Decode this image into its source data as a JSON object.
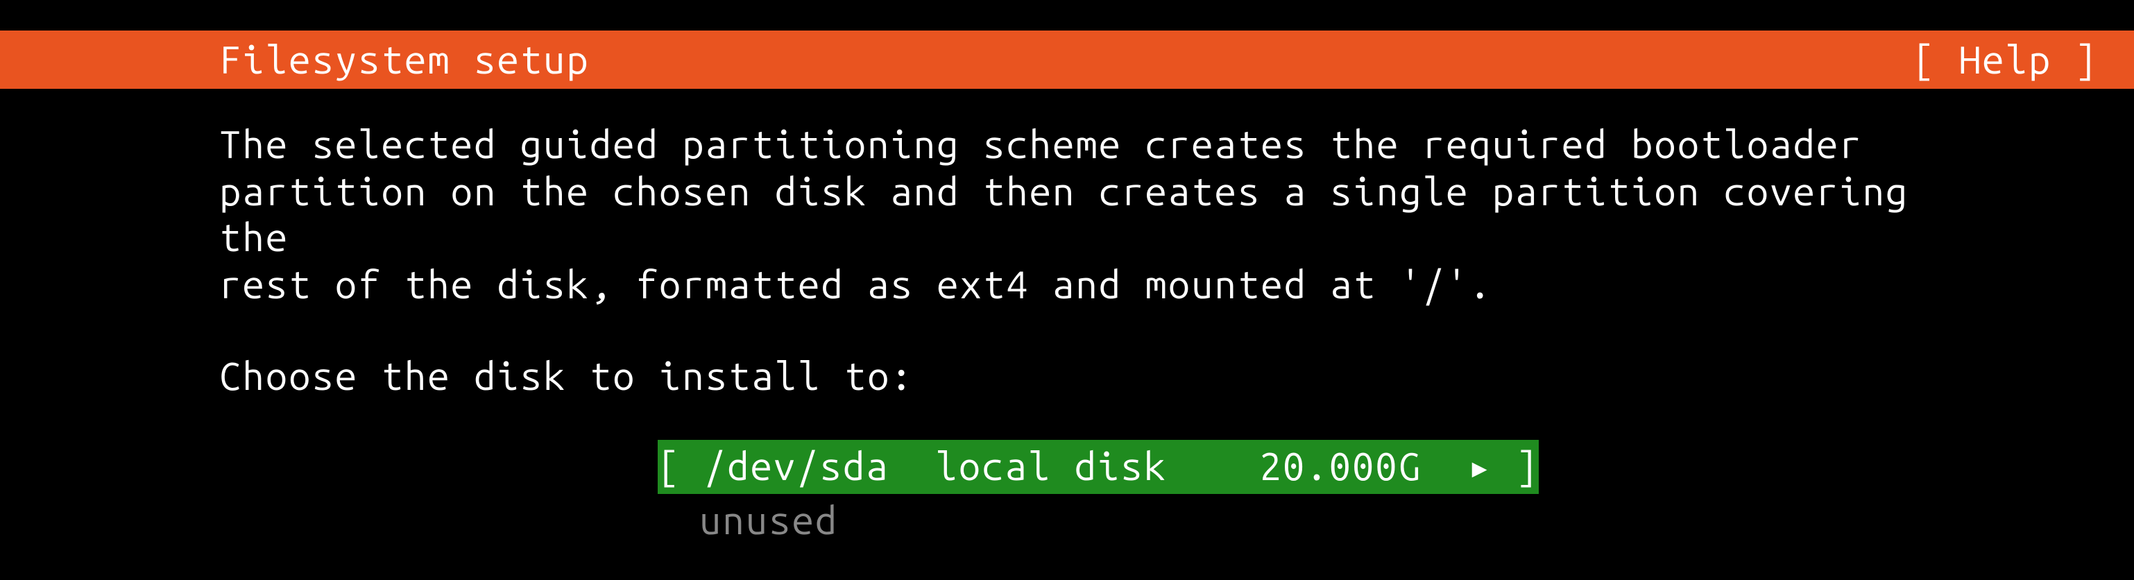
{
  "header": {
    "title": "Filesystem setup",
    "help_label": "[ Help ]"
  },
  "content": {
    "description": "The selected guided partitioning scheme creates the required bootloader\npartition on the chosen disk and then creates a single partition covering the\nrest of the disk, formatted as ext4 and mounted at '/'.",
    "prompt": "Choose the disk to install to:",
    "disk": {
      "bracket_open": "[ ",
      "device": "/dev/sda",
      "spacer1": "  ",
      "type": "local disk",
      "spacer2": "    ",
      "size": "20.000G",
      "spacer3": "  ",
      "arrow": "▸",
      "bracket_close": " ]",
      "status": "unused"
    }
  }
}
